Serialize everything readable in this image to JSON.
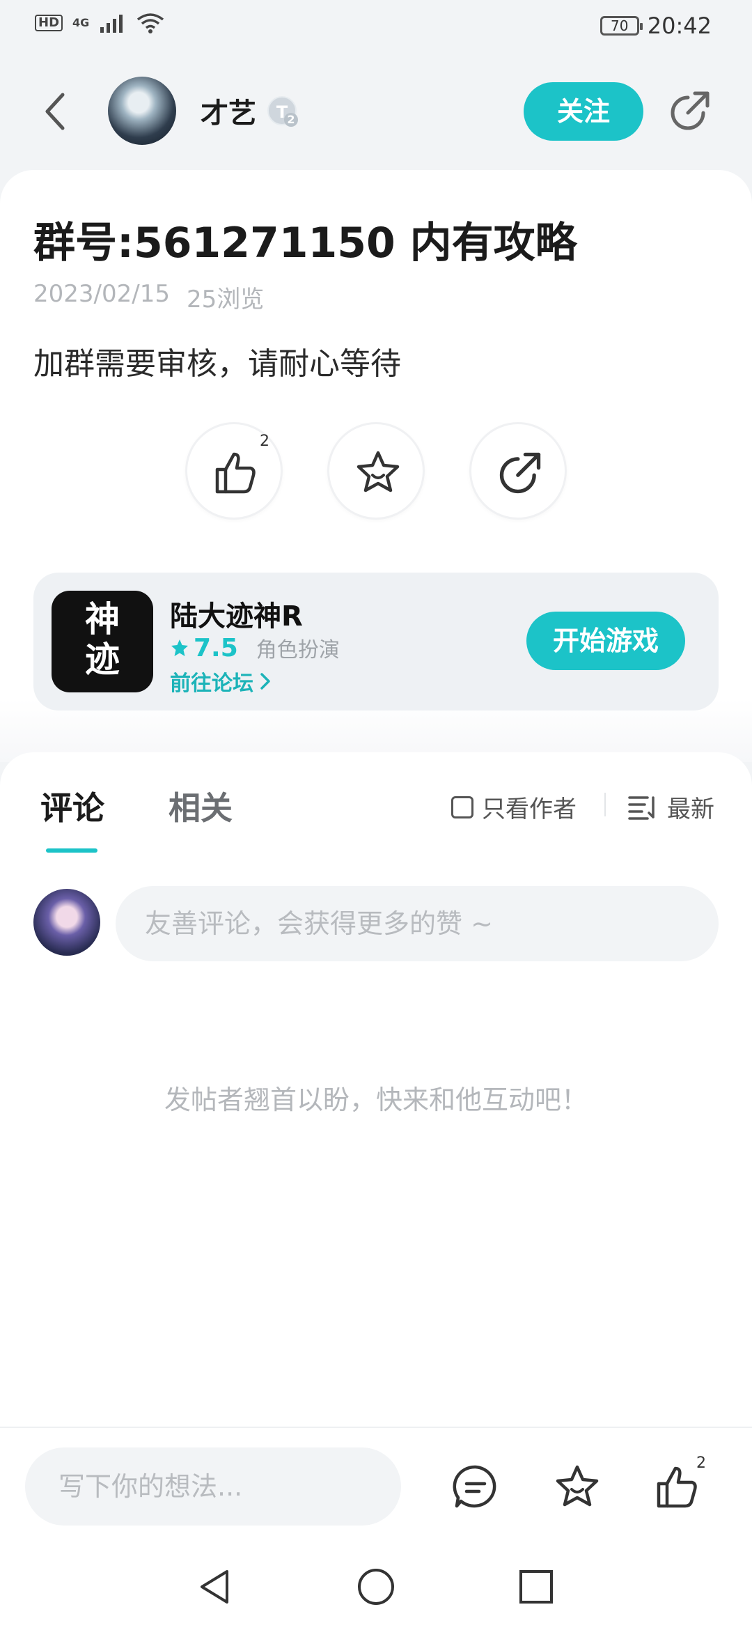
{
  "status_bar": {
    "hd": "HD",
    "network": "4G",
    "battery": "70",
    "time": "20:42"
  },
  "header": {
    "author_name": "才艺",
    "level_badge": "T",
    "level_num": "2",
    "follow_label": "关注"
  },
  "post": {
    "title": "群号:561271150  内有攻略",
    "date": "2023/02/15",
    "views": "25浏览",
    "body": "加群需要审核，请耐心等待",
    "like_count": "2"
  },
  "game": {
    "icon_text_1": "神",
    "icon_text_2": "迹",
    "name": "陆大迹神R",
    "rating": "7.5",
    "genre": "角色扮演",
    "forum_link": "前往论坛",
    "start_label": "开始游戏"
  },
  "comments": {
    "tab_comments": "评论",
    "tab_related": "相关",
    "author_only": "只看作者",
    "sort_label": "最新",
    "input_placeholder": "友善评论，会获得更多的赞 ~",
    "empty_tip": "发帖者翘首以盼，快来和他互动吧！"
  },
  "bottom_bar": {
    "write_placeholder": "写下你的想法...",
    "like_count": "2"
  },
  "colors": {
    "accent": "#1cc3c8",
    "background": "#f2f4f6"
  }
}
